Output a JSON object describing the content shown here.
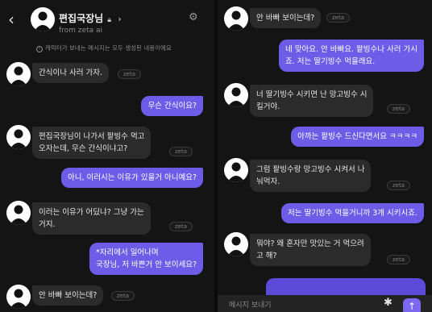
{
  "header": {
    "title": "편집국장님",
    "subtitle": "from zeta ai",
    "notice": "캐릭터가 보내는 메시지는 모두 생성된 내용이에요"
  },
  "zeta_tag": "zeta",
  "left_messages": [
    {
      "role": "bot",
      "lines": [
        "간식이나 사러 가자."
      ]
    },
    {
      "role": "user",
      "lines": [
        "무슨 간식이요?"
      ]
    },
    {
      "role": "bot",
      "lines": [
        "편집국장님이 나가서 팥빙수 먹고",
        "오자는데, 무슨 간식이냐고?"
      ]
    },
    {
      "role": "user",
      "lines": [
        "아니, 이러시는 이유가 있을거 아니예요?"
      ]
    },
    {
      "role": "bot",
      "lines": [
        "이러는 이유가 어딨냐? 그냥 가는",
        "거지."
      ]
    },
    {
      "role": "user",
      "lines": [
        "*자리에서 일어나며",
        "국장님, 저 바쁜거 안 보이세요?"
      ]
    },
    {
      "role": "bot",
      "lines": [
        "안 바빠 보이는데?"
      ]
    }
  ],
  "right_messages": [
    {
      "role": "bot",
      "lines": [
        "안 바빠 보이는데?"
      ]
    },
    {
      "role": "user",
      "lines": [
        "네 맞아요. 안 바빠요. 팥빙수나 사러 가시",
        "죠. 저는 딸기빙수 먹을래요."
      ]
    },
    {
      "role": "bot",
      "lines": [
        "너 딸기빙수 시키면 난 망고빙수 시",
        "킬거야."
      ]
    },
    {
      "role": "user",
      "lines": [
        "아까는 팥빙수 드신다면서요 ㅋㅋㅋㅋ"
      ]
    },
    {
      "role": "bot",
      "lines": [
        "그럼 팥빙수랑 망고빙수 시켜서 나",
        "눠먹자."
      ]
    },
    {
      "role": "user",
      "lines": [
        "저는 딸기빙수 먹을거니까 3개 시키시죠."
      ]
    },
    {
      "role": "bot",
      "lines": [
        "뭐야? 왜 혼자만 맛있는 거 먹으려",
        "고 해?"
      ]
    }
  ],
  "input": {
    "placeholder": "메시지 보내기"
  }
}
